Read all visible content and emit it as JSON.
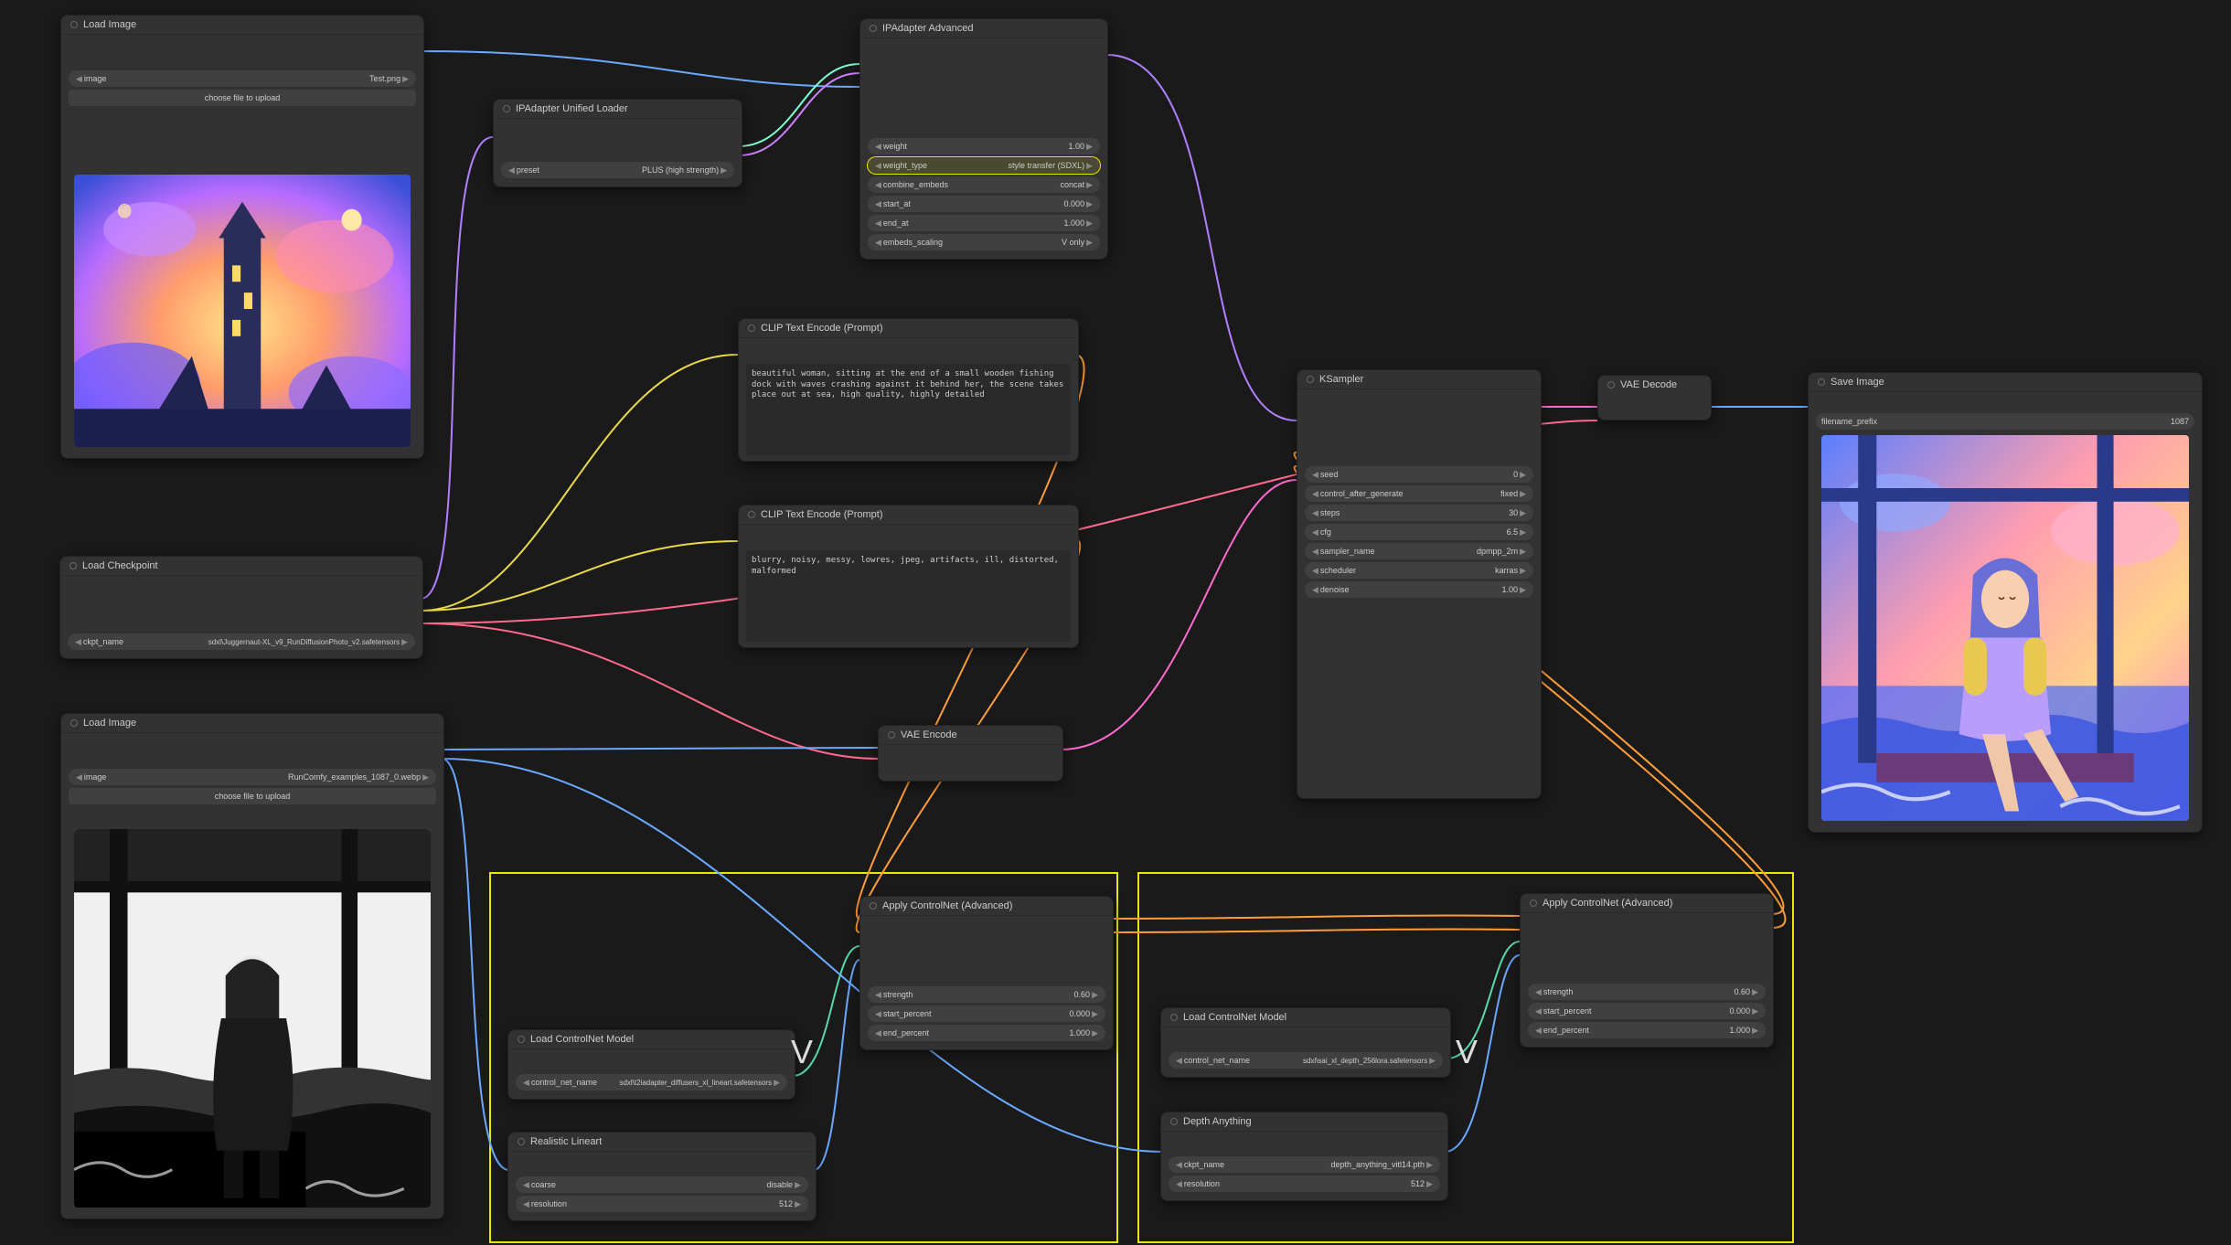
{
  "nodes": {
    "load_image_1": {
      "title": "Load Image",
      "image_param": "image",
      "image_value": "Test.png",
      "upload_btn": "choose file to upload"
    },
    "ip_unified": {
      "title": "IPAdapter Unified Loader",
      "preset_label": "preset",
      "preset_value": "PLUS (high strength)"
    },
    "ip_advanced": {
      "title": "IPAdapter Advanced",
      "params": [
        {
          "label": "weight",
          "value": "1.00"
        },
        {
          "label": "weight_type",
          "value": "style transfer (SDXL)",
          "highlight": true
        },
        {
          "label": "combine_embeds",
          "value": "concat"
        },
        {
          "label": "start_at",
          "value": "0.000"
        },
        {
          "label": "end_at",
          "value": "1.000"
        },
        {
          "label": "embeds_scaling",
          "value": "V only"
        }
      ]
    },
    "clip_pos": {
      "title": "CLIP Text Encode (Prompt)",
      "text": "beautiful woman, sitting at the end of a small wooden fishing dock with waves crashing against it behind her, the scene takes place out at sea, high quality, highly detailed"
    },
    "clip_neg": {
      "title": "CLIP Text Encode (Prompt)",
      "text": "blurry, noisy, messy, lowres, jpeg, artifacts, ill, distorted, malformed"
    },
    "load_ckpt": {
      "title": "Load Checkpoint",
      "label": "ckpt_name",
      "value": "sdxl\\Juggernaut-XL_v9_RunDiffusionPhoto_v2.safetensors"
    },
    "load_image_2": {
      "title": "Load Image",
      "image_param": "image",
      "image_value": "RunComfy_examples_1087_0.webp",
      "upload_btn": "choose file to upload"
    },
    "vae_encode": {
      "title": "VAE Encode"
    },
    "ksampler": {
      "title": "KSampler",
      "params": [
        {
          "label": "seed",
          "value": "0"
        },
        {
          "label": "control_after_generate",
          "value": "fixed"
        },
        {
          "label": "steps",
          "value": "30"
        },
        {
          "label": "cfg",
          "value": "6.5"
        },
        {
          "label": "sampler_name",
          "value": "dpmpp_2m"
        },
        {
          "label": "scheduler",
          "value": "karras"
        },
        {
          "label": "denoise",
          "value": "1.00"
        }
      ]
    },
    "vae_decode": {
      "title": "VAE Decode"
    },
    "save_image": {
      "title": "Save Image",
      "prefix_label": "filename_prefix",
      "prefix_value": "1087"
    },
    "apply_cn_1": {
      "title": "Apply ControlNet (Advanced)",
      "params": [
        {
          "label": "strength",
          "value": "0.60"
        },
        {
          "label": "start_percent",
          "value": "0.000"
        },
        {
          "label": "end_percent",
          "value": "1.000"
        }
      ]
    },
    "load_cn_1": {
      "title": "Load ControlNet Model",
      "label": "control_net_name",
      "value": "sdxl\\t2iadapter_diffusers_xl_lineart.safetensors"
    },
    "realistic_lineart": {
      "title": "Realistic Lineart",
      "params": [
        {
          "label": "coarse",
          "value": "disable"
        },
        {
          "label": "resolution",
          "value": "512"
        }
      ]
    },
    "apply_cn_2": {
      "title": "Apply ControlNet (Advanced)",
      "params": [
        {
          "label": "strength",
          "value": "0.60"
        },
        {
          "label": "start_percent",
          "value": "0.000"
        },
        {
          "label": "end_percent",
          "value": "1.000"
        }
      ]
    },
    "load_cn_2": {
      "title": "Load ControlNet Model",
      "label": "control_net_name",
      "value": "sdxl\\sai_xl_depth_256lora.safetensors"
    },
    "depth_anything": {
      "title": "Depth Anything",
      "params": [
        {
          "label": "ckpt_name",
          "value": "depth_anything_vitl14.pth"
        },
        {
          "label": "resolution",
          "value": "512"
        }
      ]
    }
  }
}
